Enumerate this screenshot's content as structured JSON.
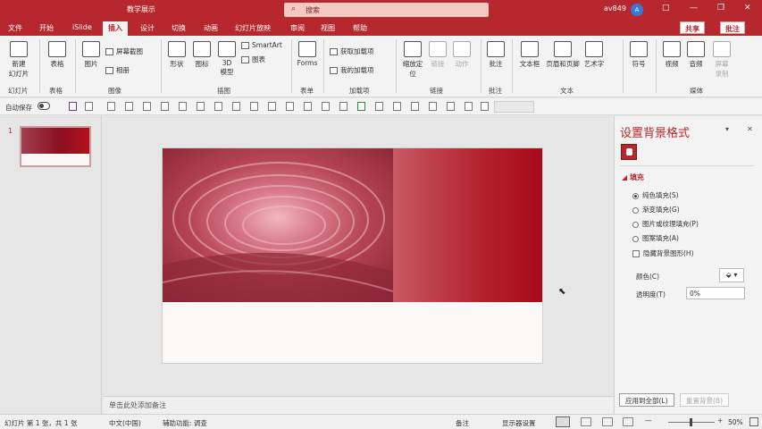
{
  "titlebar": {
    "title": "教学展示",
    "search_placeholder": "搜索",
    "user": "av849",
    "avatar": "A",
    "controls": [
      "□",
      "—",
      "❐",
      "✕"
    ]
  },
  "tabs": [
    "文件",
    "开始",
    "iSlide",
    "插入",
    "设计",
    "切换",
    "动画",
    "幻灯片放映",
    "审阅",
    "视图",
    "帮助"
  ],
  "active_tab": "插入",
  "share_label": "共享",
  "comment_label": "批注",
  "ribbon": {
    "buttons": [
      {
        "label": "新建\n幻灯片"
      },
      {
        "label": "表格"
      },
      {
        "label": "图片"
      },
      {
        "label": "形状"
      },
      {
        "label": "图标"
      },
      {
        "label": "3D\n模型"
      },
      {
        "label": "Forms"
      },
      {
        "label": "缩放定\n位"
      },
      {
        "label": "链接"
      },
      {
        "label": "动作"
      },
      {
        "label": "批注"
      },
      {
        "label": "文本框"
      },
      {
        "label": "页眉和页脚"
      },
      {
        "label": "艺术字"
      },
      {
        "label": "符号"
      },
      {
        "label": "视频"
      },
      {
        "label": "音频"
      },
      {
        "label": "屏幕\n录制"
      }
    ],
    "small": [
      "屏幕截图",
      "相册",
      "SmartArt",
      "图表",
      "获取加载项",
      "我的加载项"
    ],
    "groups": [
      "幻灯片",
      "表格",
      "图像",
      "插图",
      "表单",
      "加载项",
      "链接",
      "批注",
      "文本",
      "媒体"
    ]
  },
  "qat": {
    "autosave": "自动保存"
  },
  "thumbnail": {
    "number": "1"
  },
  "notes_placeholder": "单击此处添加备注",
  "pane": {
    "title": "设置背景格式",
    "section": "填充",
    "options": [
      "纯色填充(S)",
      "渐变填充(G)",
      "图片或纹理填充(P)",
      "图案填充(A)"
    ],
    "selected_option": "纯色填充(S)",
    "hide_bg": "隐藏背景图形(H)",
    "color_label": "颜色(C)",
    "transparency_label": "透明度(T)",
    "transparency_value": "0%",
    "apply_all": "应用到全部(L)",
    "reset": "重置背景(B)"
  },
  "status": {
    "slide_info": "幻灯片 第 1 张，共 1 张",
    "language": "中文(中国)",
    "accessibility": "辅助功能: 调查",
    "notes": "备注",
    "display": "显示器设置",
    "zoom": "50%"
  },
  "colors": {
    "accent": "#b7282e",
    "slide_red": "#a80a18"
  }
}
